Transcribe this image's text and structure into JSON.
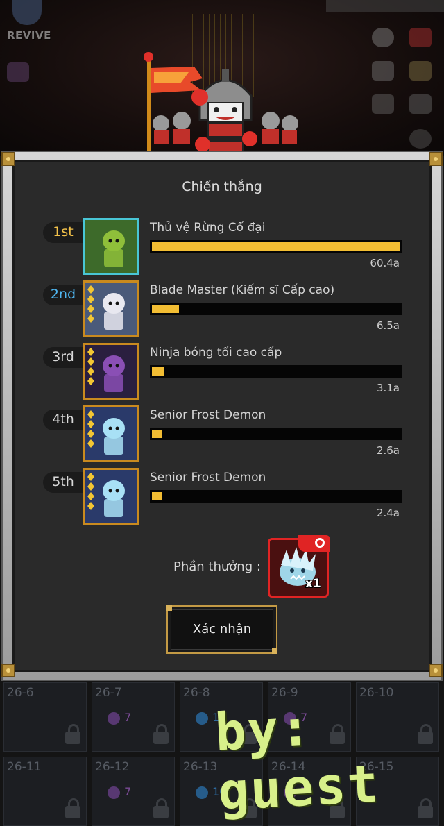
{
  "hud": {
    "revive_label": "REVIVE"
  },
  "dialog": {
    "title": "Chiến thắng",
    "ranking": [
      {
        "rank": "1st",
        "rank_color": "#f2c14a",
        "name": "Thủ vệ Rừng Cổ đại",
        "value_text": "60.4a",
        "share": 1.0,
        "frame": "teal",
        "stars": 0
      },
      {
        "rank": "2nd",
        "rank_color": "#4fb6f0",
        "name": "Blade Master (Kiếm sĩ Cấp cao)",
        "value_text": "6.5a",
        "share": 0.108,
        "frame": "gold",
        "stars": 4
      },
      {
        "rank": "3rd",
        "rank_color": "#d8d8d8",
        "name": "Ninja bóng tối cao cấp",
        "value_text": "3.1a",
        "share": 0.051,
        "frame": "gold",
        "stars": 4
      },
      {
        "rank": "4th",
        "rank_color": "#d8d8d8",
        "name": "Senior Frost Demon",
        "value_text": "2.6a",
        "share": 0.043,
        "frame": "gold",
        "stars": 4
      },
      {
        "rank": "5th",
        "rank_color": "#d8d8d8",
        "name": "Senior Frost Demon",
        "value_text": "2.4a",
        "share": 0.04,
        "frame": "gold",
        "stars": 4
      }
    ],
    "reward_label": "Phần thưởng :",
    "reward_quantity": "x1",
    "confirm_label": "Xác nhận"
  },
  "stages": [
    {
      "label": "26-6",
      "gem": "",
      "count": ""
    },
    {
      "label": "26-7",
      "gem": "purple",
      "count": "7"
    },
    {
      "label": "26-8",
      "gem": "blue",
      "count": "1"
    },
    {
      "label": "26-9",
      "gem": "purple",
      "count": "7"
    },
    {
      "label": "26-10",
      "gem": "",
      "count": ""
    },
    {
      "label": "26-11",
      "gem": "",
      "count": ""
    },
    {
      "label": "26-12",
      "gem": "purple",
      "count": "7"
    },
    {
      "label": "26-13",
      "gem": "blue",
      "count": "10"
    },
    {
      "label": "26-14",
      "gem": "purple",
      "count": "7"
    },
    {
      "label": "26-15",
      "gem": "",
      "count": ""
    }
  ],
  "watermark": "by: guest",
  "colors": {
    "bar_fill": "#f2bd33",
    "frame_gold": "#c98a1f",
    "frame_teal": "#49c6d6",
    "reward_red": "#e02424",
    "gem_purple": "#8a4fb5",
    "gem_blue": "#2f8fe0"
  }
}
